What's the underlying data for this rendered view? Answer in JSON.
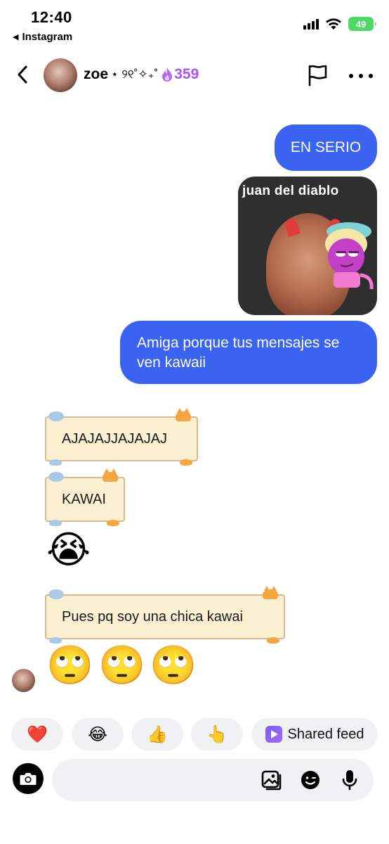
{
  "status_bar": {
    "time": "12:40",
    "back_app": "Instagram",
    "battery": "49"
  },
  "header": {
    "name": "zoe",
    "name_decoration": "⋆ ୨୧˚✧₊˚",
    "streak_icon": "fire-icon",
    "streak_count": "359"
  },
  "messages": {
    "out_1": "EN SERIO",
    "photo_caption": "juan del diablo",
    "out_2": "Amiga porque tus mensajes se ven kawaii",
    "in_1": "AJAJAJJAJAJAJ",
    "in_2": "KAWAI",
    "in_emoji_1": "😭",
    "in_3": "Pues pq soy una chica kawai",
    "in_emoji_2": [
      "🙄",
      "🙄",
      "🙄"
    ]
  },
  "quick_replies": {
    "r1": "❤️",
    "r2": "😂",
    "r3": "👍",
    "r4": "👆",
    "shared_feed": "Shared feed"
  },
  "composer": {
    "placeholder": ""
  },
  "colors": {
    "outgoing_bubble": "#3a63f2",
    "kawaii_bubble": "#fbefd2",
    "streak": "#a855f7",
    "battery": "#4cd964"
  }
}
